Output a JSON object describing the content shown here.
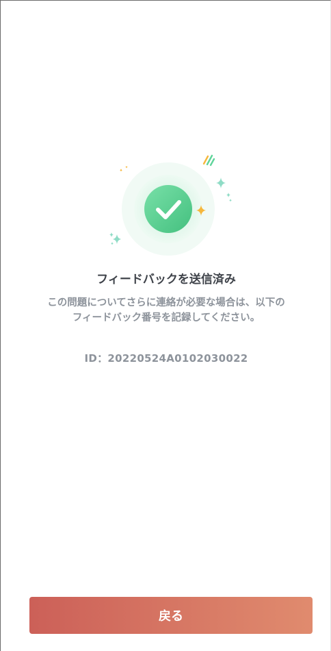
{
  "feedback": {
    "title": "フィードバックを送信済み",
    "description_line1": "この問題についてさらに連絡が必要な場合は、以下の",
    "description_line2": "フィードバック番号を記録してください。",
    "id_text": "ID：20220524A0102030022"
  },
  "actions": {
    "back_label": "戻る"
  },
  "icons": {
    "success": "check-circle-icon"
  },
  "colors": {
    "success_green": "#5fd49a",
    "button_start": "#cc6058",
    "button_end": "#e08b6e",
    "sparkle_orange": "#f6b73c"
  }
}
